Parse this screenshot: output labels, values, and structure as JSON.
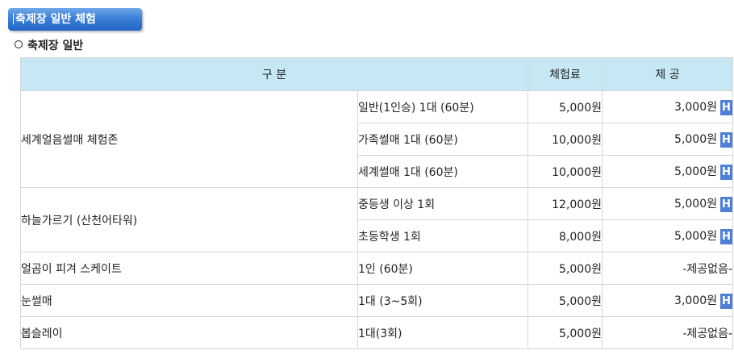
{
  "header": {
    "title": "축제장 일반 체험"
  },
  "section": {
    "title": "축제장 일반"
  },
  "table": {
    "headers": {
      "category": "구 분",
      "price": "체험료",
      "provided": "제 공"
    },
    "badge": "H",
    "categories": [
      {
        "name": "세계얼음썰매 체험존"
      },
      {
        "name": "하늘가르기 (산천어타워)"
      },
      {
        "name": "얼곰이 피겨 스케이트"
      },
      {
        "name": "눈썰매"
      },
      {
        "name": "봅슬레이"
      }
    ],
    "rows": [
      {
        "option": "일반(1인승) 1대 (60분)",
        "price": "5,000원",
        "provided": "3,000원"
      },
      {
        "option": "가족썰매 1대 (60분)",
        "price": "10,000원",
        "provided": "5,000원"
      },
      {
        "option": "세계썰매 1대 (60분)",
        "price": "10,000원",
        "provided": "5,000원"
      },
      {
        "option": "중등생 이상 1회",
        "price": "12,000원",
        "provided": "5,000원"
      },
      {
        "option": "초등학생 1회",
        "price": "8,000원",
        "provided": "5,000원"
      },
      {
        "option": "1인 (60분)",
        "price": "5,000원",
        "provided": "-제공없음-"
      },
      {
        "option": "1대 (3~5회)",
        "price": "5,000원",
        "provided": "3,000원"
      },
      {
        "option": "1대(3회)",
        "price": "5,000원",
        "provided": "-제공없음-"
      }
    ]
  }
}
